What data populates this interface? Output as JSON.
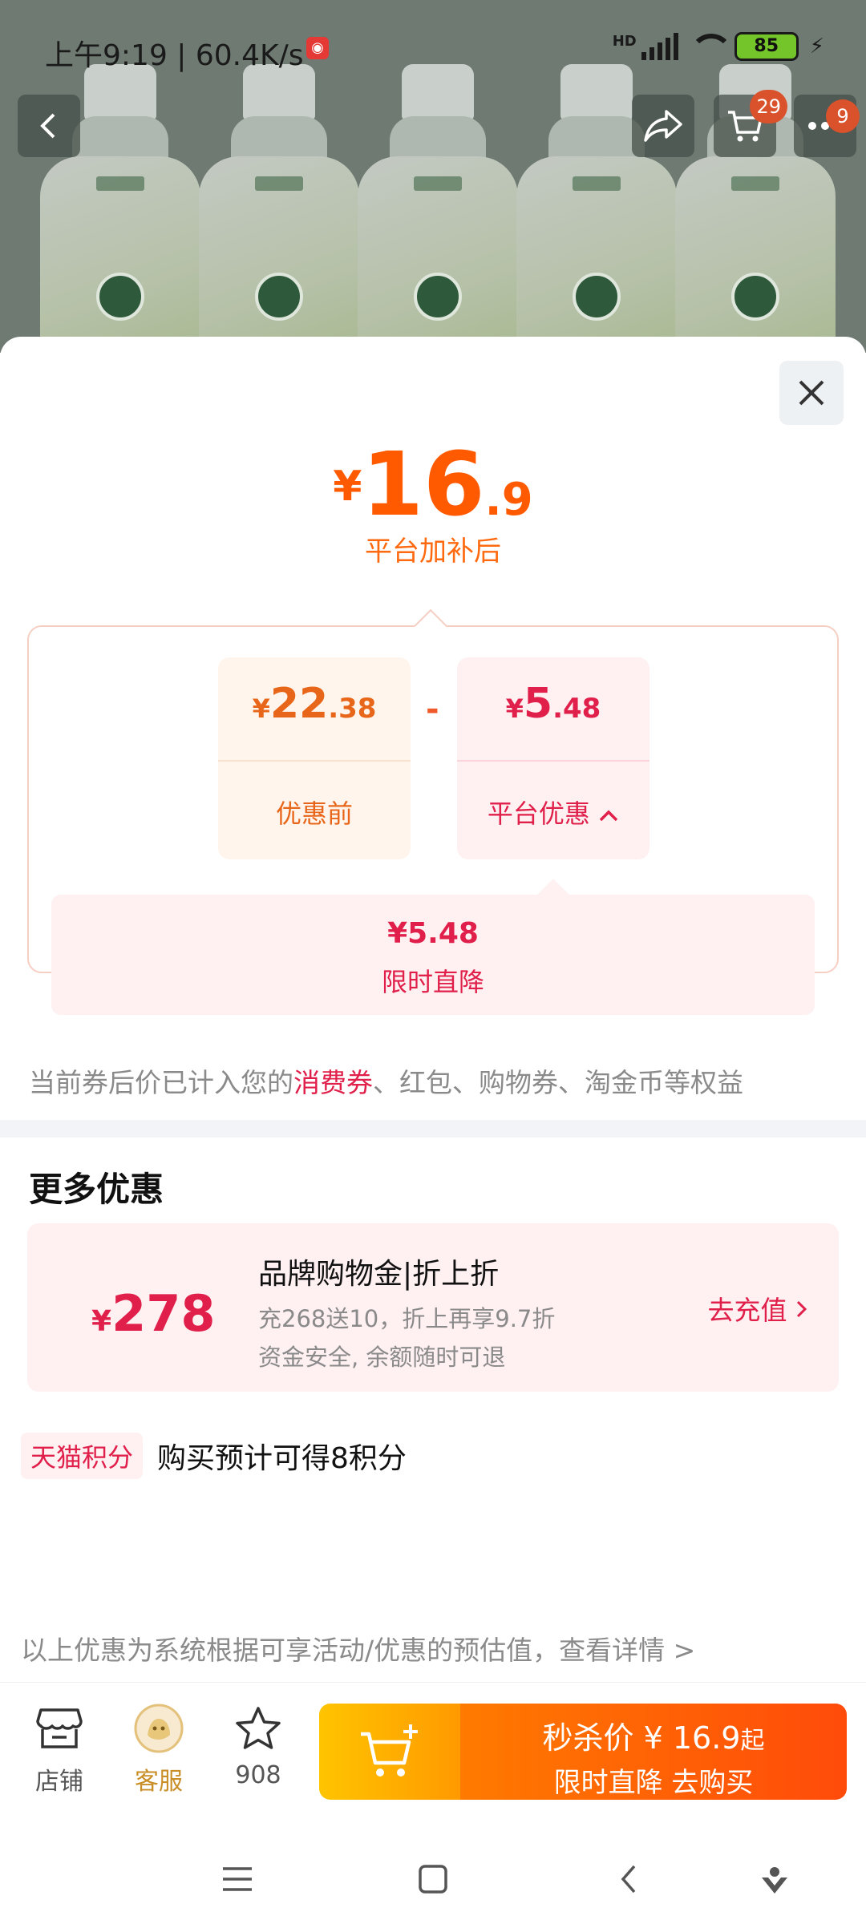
{
  "status_bar": {
    "time": "上午9:19",
    "network_speed": "60.4K/s",
    "network_type": "HD",
    "battery": "85"
  },
  "nav": {
    "cart_badge": "29",
    "more_badge": "9"
  },
  "price": {
    "yen": "¥",
    "integer": "16",
    "decimal": ".9",
    "subtitle": "平台加补后"
  },
  "breakdown": {
    "before": {
      "yen": "¥",
      "integer": "22",
      "decimal": ".38",
      "label": "优惠前"
    },
    "minus": "-",
    "discount": {
      "yen": "¥",
      "integer": "5",
      "decimal": ".48",
      "label": "平台优惠"
    },
    "detail": {
      "value": "¥5.48",
      "label": "限时直降"
    }
  },
  "note": {
    "prefix": "当前券后价已计入您的",
    "highlight": "消费券",
    "suffix": "、红包、购物券、淘金币等权益"
  },
  "more": {
    "title": "更多优惠",
    "promo": {
      "yen": "¥",
      "amount": "278",
      "title": "品牌购物金|折上折",
      "line1": "充268送10，折上再享9.7折",
      "line2": "资金安全, 余额随时可退",
      "action": "去充值"
    }
  },
  "points": {
    "tag": "天猫积分",
    "text": "购买预计可得8积分"
  },
  "disclaimer": "以上优惠为系统根据可享活动/优惠的预估值，查看详情 >",
  "bottom_bar": {
    "store_label": "店铺",
    "service_label": "客服",
    "favorite_count": "908",
    "buy": {
      "line1_prefix": "秒杀价 ¥ ",
      "line1_price": "16.9",
      "line1_suffix": "起",
      "line2": "限时直降  去购买"
    }
  },
  "colors": {
    "accent_orange": "#ff5a00",
    "accent_red": "#e01f4a",
    "buy_gradient_start": "#ff7a00",
    "buy_gradient_end": "#ff4b0a"
  }
}
